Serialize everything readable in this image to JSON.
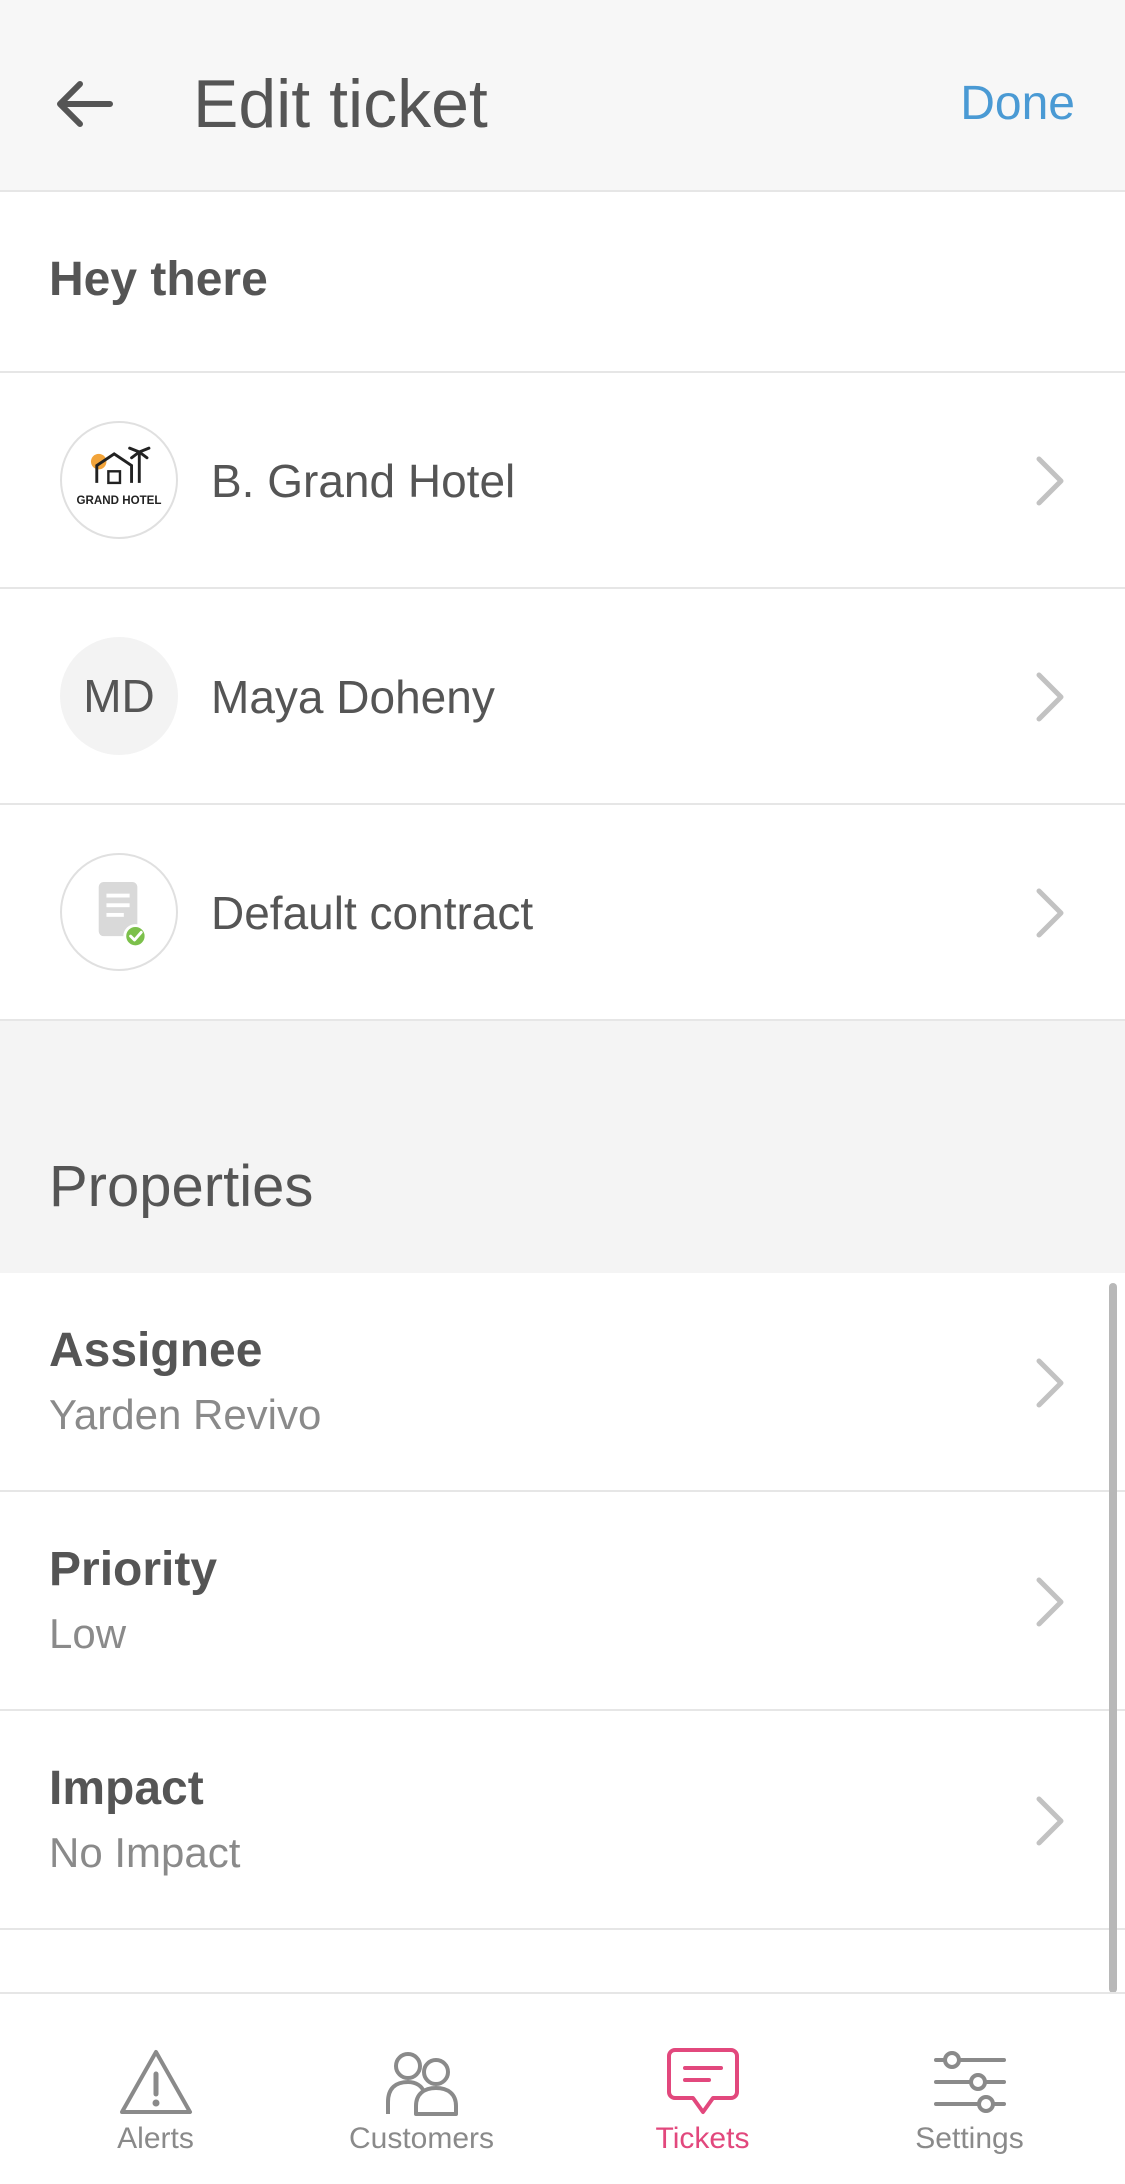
{
  "header": {
    "title": "Edit ticket",
    "done_label": "Done",
    "back_icon": "arrow-left-icon"
  },
  "greeting": "Hey there",
  "entities": [
    {
      "label": "B. Grand Hotel",
      "logo_text": "GRAND HOTEL"
    },
    {
      "label": "Maya Doheny",
      "initials": "MD"
    },
    {
      "label": "Default contract",
      "icon": "document-check-icon"
    }
  ],
  "properties_section": {
    "title": "Properties",
    "items": [
      {
        "label": "Assignee",
        "value": "Yarden Revivo"
      },
      {
        "label": "Priority",
        "value": "Low"
      },
      {
        "label": "Impact",
        "value": "No Impact"
      }
    ]
  },
  "tabbar": {
    "items": [
      {
        "label": "Alerts",
        "icon": "alert-triangle-icon"
      },
      {
        "label": "Customers",
        "icon": "users-icon"
      },
      {
        "label": "Tickets",
        "icon": "chat-bubble-icon",
        "active": true
      },
      {
        "label": "Settings",
        "icon": "sliders-icon"
      }
    ]
  },
  "colors": {
    "accent": "#4a9ad4",
    "active_tab": "#e2487d",
    "text": "#555555",
    "muted": "#8a8a8a",
    "check_green": "#7cc04b"
  }
}
